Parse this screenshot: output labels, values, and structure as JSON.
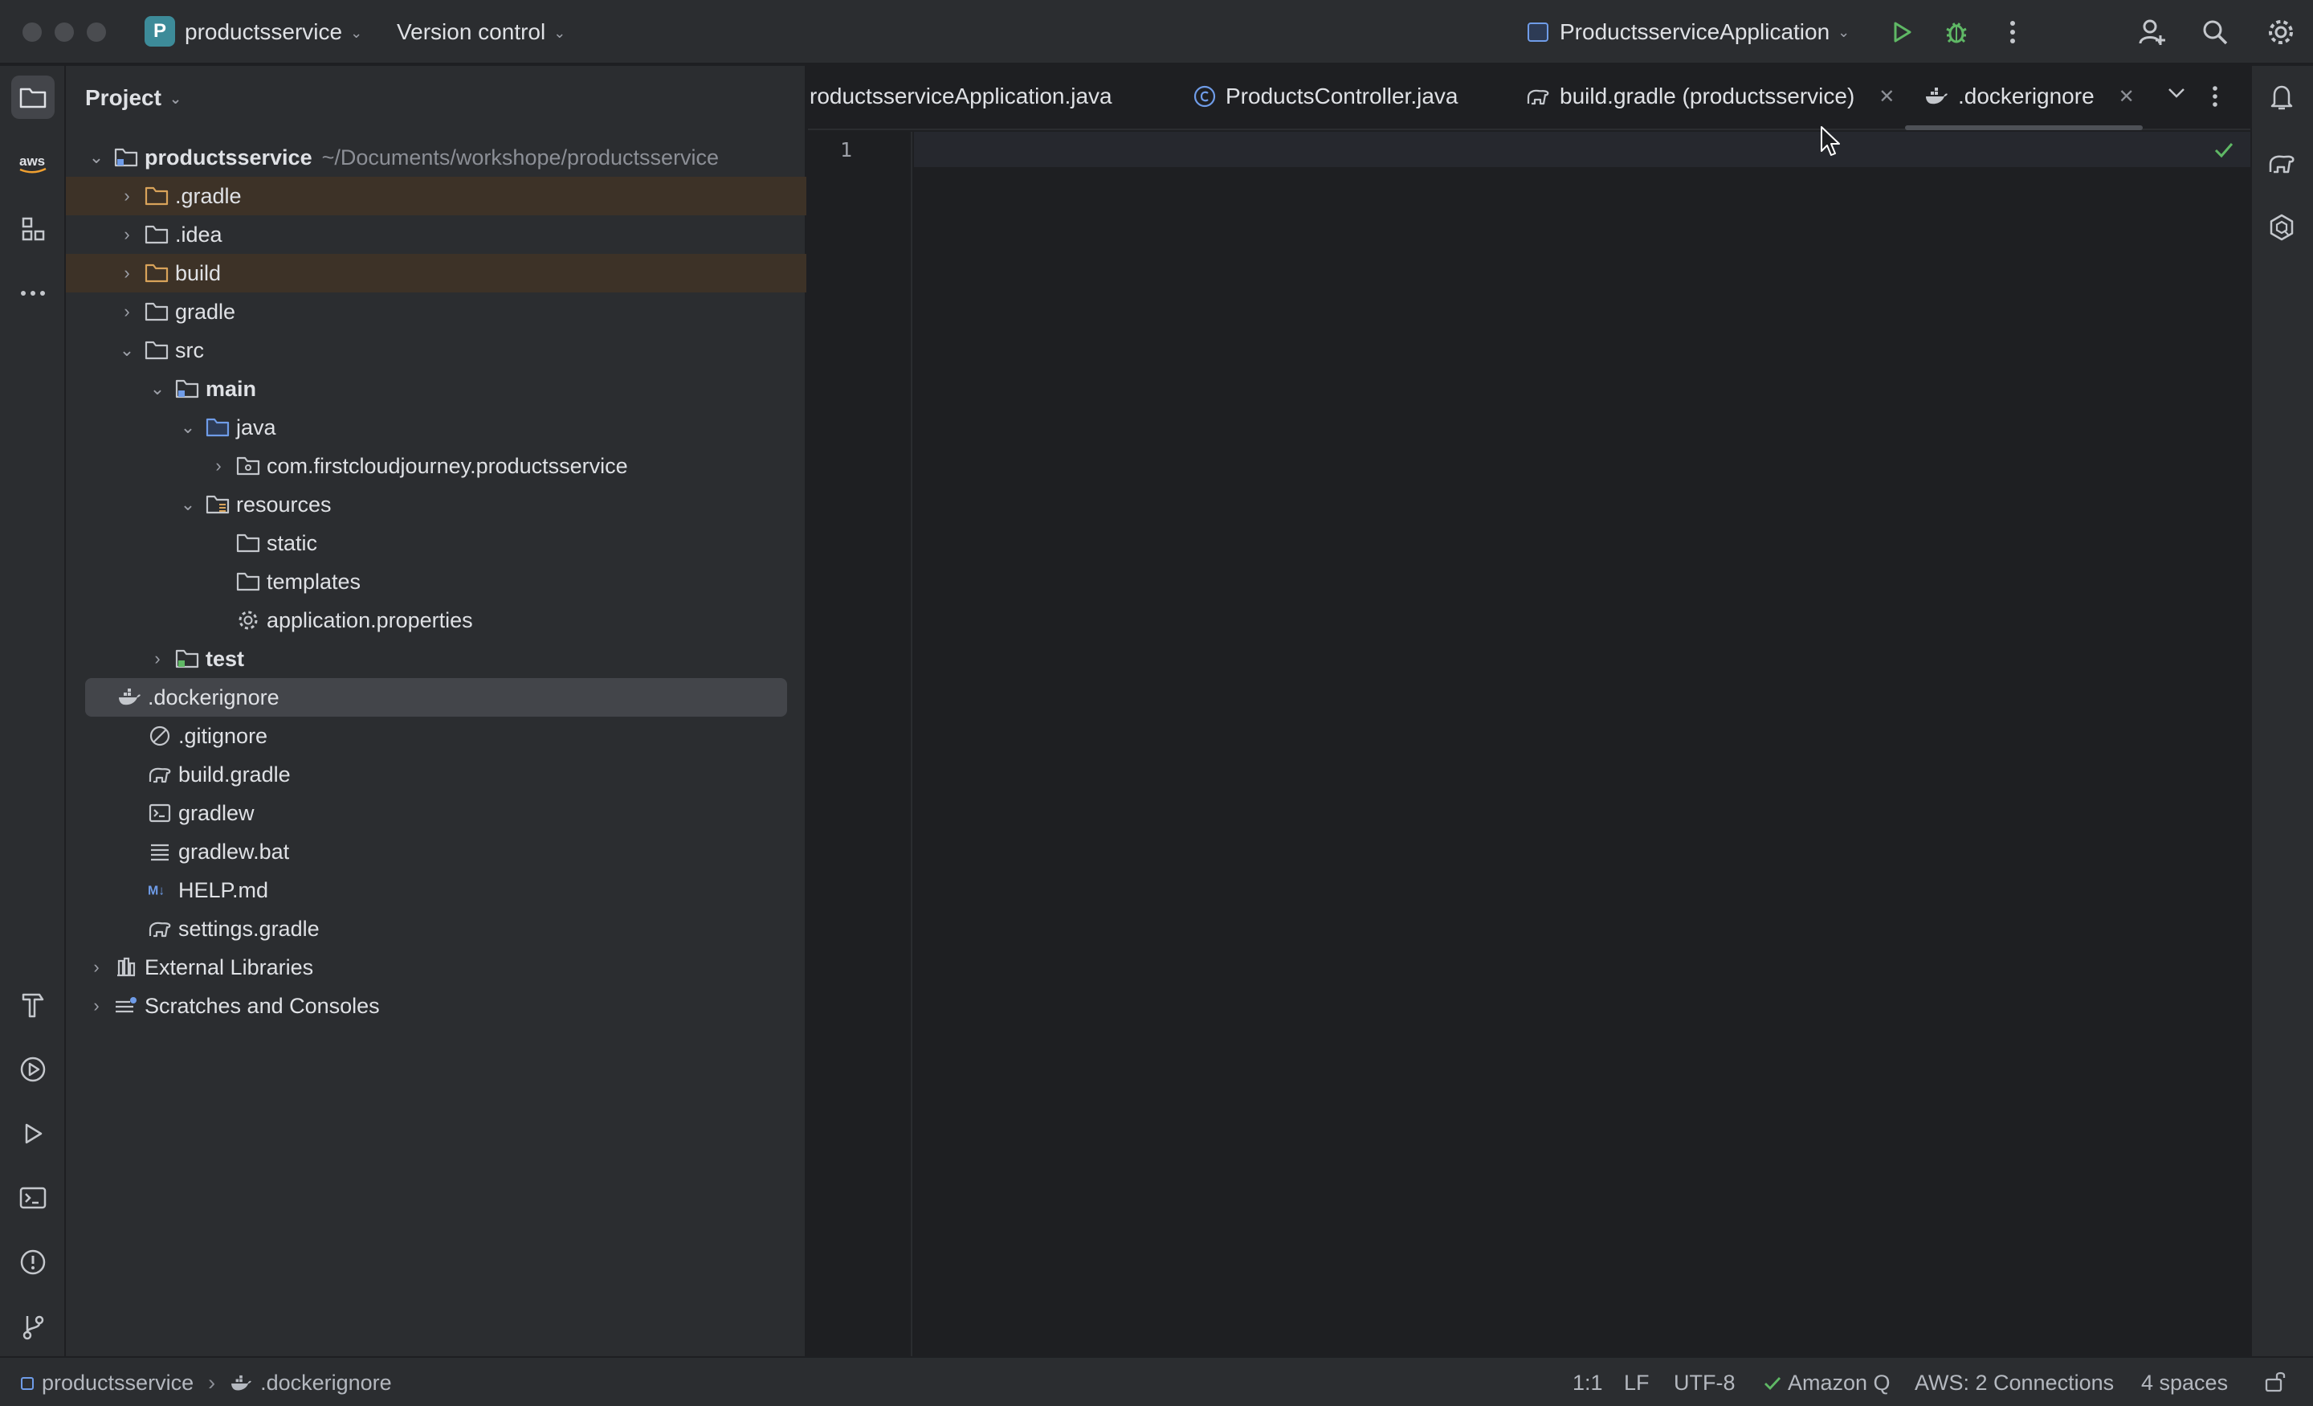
{
  "titlebar": {
    "project_badge": "P",
    "project_name": "productsservice",
    "vcs_label": "Version control",
    "run_config": "ProductsserviceApplication"
  },
  "project_panel": {
    "title": "Project",
    "tree": [
      {
        "label": "productsservice",
        "path": "~/Documents/workshope/productsservice",
        "icon": "module-folder-icon",
        "expanded": true
      },
      {
        "label": ".gradle",
        "icon": "folder-excluded-icon",
        "excluded": true
      },
      {
        "label": ".idea",
        "icon": "folder-icon"
      },
      {
        "label": "build",
        "icon": "folder-excluded-icon",
        "excluded": true
      },
      {
        "label": "gradle",
        "icon": "folder-icon"
      },
      {
        "label": "src",
        "icon": "folder-icon",
        "expanded": true
      },
      {
        "label": "main",
        "icon": "source-root-folder-icon",
        "expanded": true
      },
      {
        "label": "java",
        "icon": "java-source-folder-icon",
        "expanded": true
      },
      {
        "label": "com.firstcloudjourney.productsservice",
        "icon": "package-icon"
      },
      {
        "label": "resources",
        "icon": "resources-folder-icon",
        "expanded": true
      },
      {
        "label": "static",
        "icon": "folder-icon"
      },
      {
        "label": "templates",
        "icon": "folder-icon"
      },
      {
        "label": "application.properties",
        "icon": "gear-file-icon"
      },
      {
        "label": "test",
        "icon": "test-folder-icon"
      },
      {
        "label": ".dockerignore",
        "icon": "docker-icon",
        "selected": true
      },
      {
        "label": ".gitignore",
        "icon": "ignore-file-icon"
      },
      {
        "label": "build.gradle",
        "icon": "gradle-elephant-icon"
      },
      {
        "label": "gradlew",
        "icon": "terminal-file-icon"
      },
      {
        "label": "gradlew.bat",
        "icon": "text-file-icon"
      },
      {
        "label": "HELP.md",
        "icon": "markdown-icon"
      },
      {
        "label": "settings.gradle",
        "icon": "gradle-elephant-icon"
      },
      {
        "label": "External Libraries",
        "icon": "library-icon"
      },
      {
        "label": "Scratches and Consoles",
        "icon": "scratches-icon"
      }
    ]
  },
  "editor": {
    "tabs": [
      {
        "label": "roductsserviceApplication.java",
        "icon": "java-class-icon"
      },
      {
        "label": "ProductsController.java",
        "icon": "class-c-icon"
      },
      {
        "label": "build.gradle (productsservice)",
        "icon": "gradle-elephant-icon",
        "closable": true
      },
      {
        "label": ".dockerignore",
        "icon": "docker-icon",
        "closable": true,
        "active": true
      }
    ],
    "close_glyph": "✕",
    "line_numbers": [
      "1"
    ]
  },
  "statusbar": {
    "breadcrumb_project": "productsservice",
    "breadcrumb_file": ".dockerignore",
    "position": "1:1",
    "line_sep": "LF",
    "encoding": "UTF-8",
    "amazon_q": "Amazon Q",
    "aws": "AWS: 2 Connections",
    "indent": "4 spaces"
  },
  "colors": {
    "accent_green": "#5fb865",
    "badge_teal": "#3d8b99",
    "excluded_folder": "#d9a35a",
    "source_folder": "#6f9ce8"
  }
}
